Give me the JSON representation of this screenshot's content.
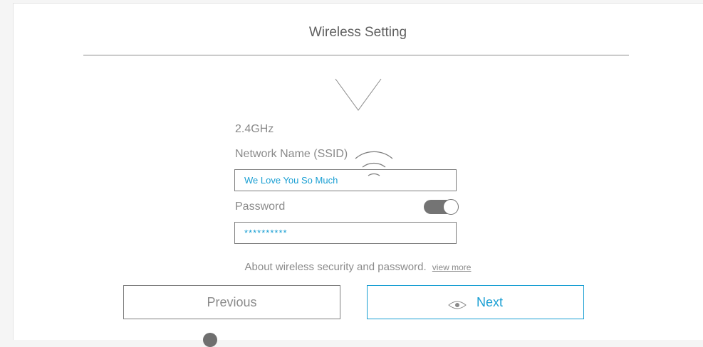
{
  "header": {
    "title": "Wireless Setting"
  },
  "band": {
    "label": "2.4GHz"
  },
  "ssid": {
    "label": "Network Name (SSID)",
    "value": "We Love You So Much"
  },
  "password": {
    "label": "Password",
    "value": "**********",
    "toggle_on": true
  },
  "help": {
    "text": "About wireless security and password.",
    "link": "view more"
  },
  "actions": {
    "previous_label": "Previous",
    "next_label": "Next"
  },
  "icons": {
    "arrow": "chevron-down-icon",
    "wifi": "wifi-icon",
    "eye": "eye-icon"
  },
  "colors": {
    "accent": "#1a9fd3",
    "text": "#8a8a8a",
    "toggle": "#747474"
  }
}
